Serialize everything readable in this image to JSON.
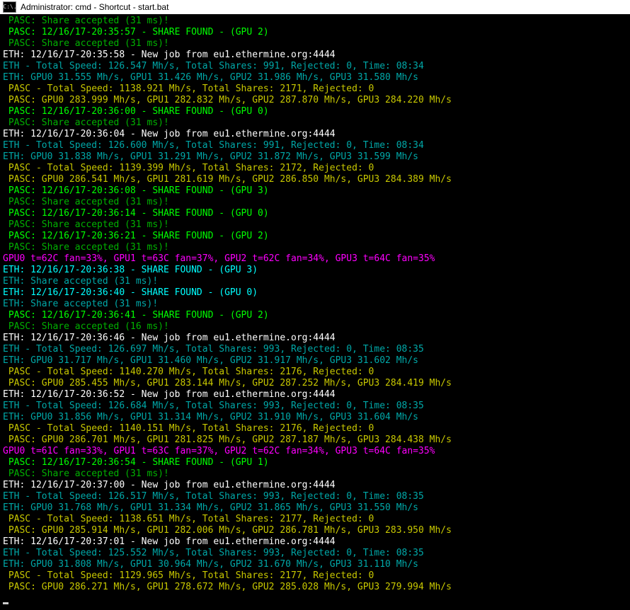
{
  "window": {
    "title": "Administrator: cmd - Shortcut - start.bat",
    "icon_label": "C:\\."
  },
  "lines": [
    {
      "class": "c-green",
      "text": " PASC: Share accepted (31 ms)!"
    },
    {
      "class": "c-lime",
      "text": " PASC: 12/16/17-20:35:57 - SHARE FOUND - (GPU 2)"
    },
    {
      "class": "c-green",
      "text": " PASC: Share accepted (31 ms)!"
    },
    {
      "class": "c-white",
      "text": "ETH: 12/16/17-20:35:58 - New job from eu1.ethermine.org:4444"
    },
    {
      "class": "c-teal",
      "text": "ETH - Total Speed: 126.547 Mh/s, Total Shares: 991, Rejected: 0, Time: 08:34"
    },
    {
      "class": "c-teal",
      "text": "ETH: GPU0 31.555 Mh/s, GPU1 31.426 Mh/s, GPU2 31.986 Mh/s, GPU3 31.580 Mh/s"
    },
    {
      "class": "c-yellow",
      "text": " PASC - Total Speed: 1138.921 Mh/s, Total Shares: 2171, Rejected: 0"
    },
    {
      "class": "c-yellow",
      "text": " PASC: GPU0 283.999 Mh/s, GPU1 282.832 Mh/s, GPU2 287.870 Mh/s, GPU3 284.220 Mh/s"
    },
    {
      "class": "c-lime",
      "text": " PASC: 12/16/17-20:36:00 - SHARE FOUND - (GPU 0)"
    },
    {
      "class": "c-green",
      "text": " PASC: Share accepted (31 ms)!"
    },
    {
      "class": "c-white",
      "text": "ETH: 12/16/17-20:36:04 - New job from eu1.ethermine.org:4444"
    },
    {
      "class": "c-teal",
      "text": "ETH - Total Speed: 126.600 Mh/s, Total Shares: 991, Rejected: 0, Time: 08:34"
    },
    {
      "class": "c-teal",
      "text": "ETH: GPU0 31.838 Mh/s, GPU1 31.291 Mh/s, GPU2 31.872 Mh/s, GPU3 31.599 Mh/s"
    },
    {
      "class": "c-yellow",
      "text": " PASC - Total Speed: 1139.399 Mh/s, Total Shares: 2172, Rejected: 0"
    },
    {
      "class": "c-yellow",
      "text": " PASC: GPU0 286.541 Mh/s, GPU1 281.619 Mh/s, GPU2 286.850 Mh/s, GPU3 284.389 Mh/s"
    },
    {
      "class": "c-lime",
      "text": " PASC: 12/16/17-20:36:08 - SHARE FOUND - (GPU 3)"
    },
    {
      "class": "c-green",
      "text": " PASC: Share accepted (31 ms)!"
    },
    {
      "class": "c-lime",
      "text": " PASC: 12/16/17-20:36:14 - SHARE FOUND - (GPU 0)"
    },
    {
      "class": "c-green",
      "text": " PASC: Share accepted (31 ms)!"
    },
    {
      "class": "c-lime",
      "text": " PASC: 12/16/17-20:36:21 - SHARE FOUND - (GPU 2)"
    },
    {
      "class": "c-green",
      "text": " PASC: Share accepted (31 ms)!"
    },
    {
      "class": "c-magenta",
      "text": "GPU0 t=62C fan=33%, GPU1 t=63C fan=37%, GPU2 t=62C fan=34%, GPU3 t=64C fan=35%"
    },
    {
      "class": "c-cyan",
      "text": "ETH: 12/16/17-20:36:38 - SHARE FOUND - (GPU 3)"
    },
    {
      "class": "c-teal",
      "text": "ETH: Share accepted (31 ms)!"
    },
    {
      "class": "c-cyan",
      "text": "ETH: 12/16/17-20:36:40 - SHARE FOUND - (GPU 0)"
    },
    {
      "class": "c-teal",
      "text": "ETH: Share accepted (31 ms)!"
    },
    {
      "class": "c-lime",
      "text": " PASC: 12/16/17-20:36:41 - SHARE FOUND - (GPU 2)"
    },
    {
      "class": "c-green",
      "text": " PASC: Share accepted (16 ms)!"
    },
    {
      "class": "c-white",
      "text": "ETH: 12/16/17-20:36:46 - New job from eu1.ethermine.org:4444"
    },
    {
      "class": "c-teal",
      "text": "ETH - Total Speed: 126.697 Mh/s, Total Shares: 993, Rejected: 0, Time: 08:35"
    },
    {
      "class": "c-teal",
      "text": "ETH: GPU0 31.717 Mh/s, GPU1 31.460 Mh/s, GPU2 31.917 Mh/s, GPU3 31.602 Mh/s"
    },
    {
      "class": "c-yellow",
      "text": " PASC - Total Speed: 1140.270 Mh/s, Total Shares: 2176, Rejected: 0"
    },
    {
      "class": "c-yellow",
      "text": " PASC: GPU0 285.455 Mh/s, GPU1 283.144 Mh/s, GPU2 287.252 Mh/s, GPU3 284.419 Mh/s"
    },
    {
      "class": "c-white",
      "text": "ETH: 12/16/17-20:36:52 - New job from eu1.ethermine.org:4444"
    },
    {
      "class": "c-teal",
      "text": "ETH - Total Speed: 126.684 Mh/s, Total Shares: 993, Rejected: 0, Time: 08:35"
    },
    {
      "class": "c-teal",
      "text": "ETH: GPU0 31.856 Mh/s, GPU1 31.314 Mh/s, GPU2 31.910 Mh/s, GPU3 31.604 Mh/s"
    },
    {
      "class": "c-yellow",
      "text": " PASC - Total Speed: 1140.151 Mh/s, Total Shares: 2176, Rejected: 0"
    },
    {
      "class": "c-yellow",
      "text": " PASC: GPU0 286.701 Mh/s, GPU1 281.825 Mh/s, GPU2 287.187 Mh/s, GPU3 284.438 Mh/s"
    },
    {
      "class": "c-magenta",
      "text": "GPU0 t=61C fan=33%, GPU1 t=63C fan=37%, GPU2 t=62C fan=34%, GPU3 t=64C fan=35%"
    },
    {
      "class": "c-lime",
      "text": " PASC: 12/16/17-20:36:54 - SHARE FOUND - (GPU 1)"
    },
    {
      "class": "c-green",
      "text": " PASC: Share accepted (31 ms)!"
    },
    {
      "class": "c-white",
      "text": "ETH: 12/16/17-20:37:00 - New job from eu1.ethermine.org:4444"
    },
    {
      "class": "c-teal",
      "text": "ETH - Total Speed: 126.517 Mh/s, Total Shares: 993, Rejected: 0, Time: 08:35"
    },
    {
      "class": "c-teal",
      "text": "ETH: GPU0 31.768 Mh/s, GPU1 31.334 Mh/s, GPU2 31.865 Mh/s, GPU3 31.550 Mh/s"
    },
    {
      "class": "c-yellow",
      "text": " PASC - Total Speed: 1138.651 Mh/s, Total Shares: 2177, Rejected: 0"
    },
    {
      "class": "c-yellow",
      "text": " PASC: GPU0 285.914 Mh/s, GPU1 282.006 Mh/s, GPU2 286.781 Mh/s, GPU3 283.950 Mh/s"
    },
    {
      "class": "c-white",
      "text": "ETH: 12/16/17-20:37:01 - New job from eu1.ethermine.org:4444"
    },
    {
      "class": "c-teal",
      "text": "ETH - Total Speed: 125.552 Mh/s, Total Shares: 993, Rejected: 0, Time: 08:35"
    },
    {
      "class": "c-teal",
      "text": "ETH: GPU0 31.808 Mh/s, GPU1 30.964 Mh/s, GPU2 31.670 Mh/s, GPU3 31.110 Mh/s"
    },
    {
      "class": "c-yellow",
      "text": " PASC - Total Speed: 1129.965 Mh/s, Total Shares: 2177, Rejected: 0"
    },
    {
      "class": "c-yellow",
      "text": " PASC: GPU0 286.271 Mh/s, GPU1 278.672 Mh/s, GPU2 285.028 Mh/s, GPU3 279.994 Mh/s"
    }
  ]
}
